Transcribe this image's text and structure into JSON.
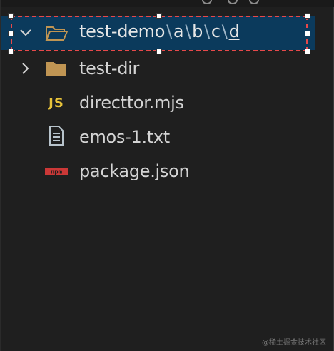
{
  "explorer": {
    "root": {
      "name": "test-demo",
      "path_segments": [
        "a",
        "b",
        "c",
        "d"
      ],
      "separator": "\\",
      "expanded": true,
      "icon": "folder-open-icon"
    },
    "items": [
      {
        "name": "test-dir",
        "type": "folder",
        "icon": "folder-icon",
        "collapsed": true
      },
      {
        "name": "directtor.mjs",
        "type": "file",
        "icon": "js-icon",
        "badge": "JS"
      },
      {
        "name": "emos-1.txt",
        "type": "file",
        "icon": "text-file-icon"
      },
      {
        "name": "package.json",
        "type": "file",
        "icon": "npm-icon",
        "badge": "npm"
      }
    ]
  },
  "colors": {
    "background": "#1f1f1f",
    "selection": "#0b3a5c",
    "folder": "#c09553",
    "js": "#e8c33a",
    "npm": "#cb3837",
    "annotation": "#e8484a"
  },
  "watermark": "@稀土掘金技术社区"
}
